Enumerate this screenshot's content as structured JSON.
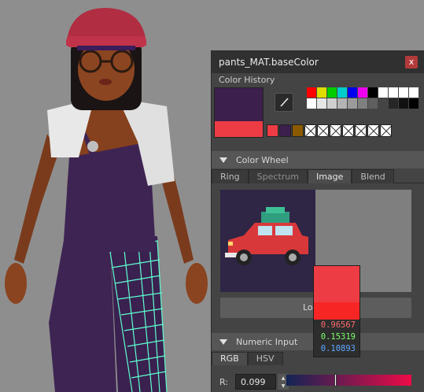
{
  "window": {
    "title": "pants_MAT.baseColor",
    "close_label": "x"
  },
  "color_history": {
    "label": "Color History",
    "current_color": "#3c1f4c",
    "new_color": "#ee3c45",
    "palette": [
      [
        "#ff0000",
        "#dddd00",
        "#00cc00",
        "#00cccc",
        "#0000ee",
        "#ee00ee",
        "#000000"
      ],
      [
        "#ffffff",
        "#e6e6e6",
        "#cfcfcf",
        "#b4b4b4",
        "#9b9b9b",
        "#7f7f7f",
        "#5f5f5f",
        "#444444",
        "#262626",
        "#111111",
        "#000000"
      ]
    ],
    "recent": [
      "#ee3c45",
      "#3c1f4c",
      "#8b5a00",
      "empty",
      "empty",
      "empty",
      "empty",
      "empty",
      "empty",
      "empty"
    ]
  },
  "color_wheel": {
    "label": "Color Wheel",
    "tabs": [
      "Ring",
      "Spectrum",
      "Image",
      "Blend"
    ],
    "active_tab": "Image",
    "load_button": "Lo"
  },
  "picker_popup": {
    "values": [
      "0.96567",
      "0.15319",
      "0.10893"
    ],
    "colors": [
      "#ff6b6b",
      "#7dff6b",
      "#5ea8ff"
    ]
  },
  "numeric_input": {
    "label": "Numeric Input",
    "tabs": [
      "RGB",
      "HSV"
    ],
    "r_label": "R:",
    "r_value": "0.099"
  }
}
